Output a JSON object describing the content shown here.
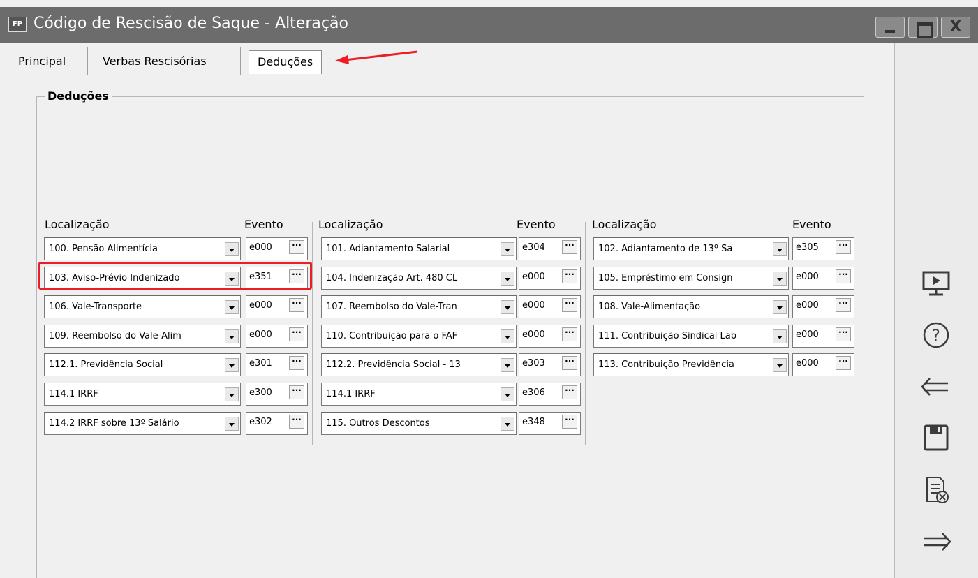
{
  "window": {
    "app_icon": "FP",
    "title": "Código de Rescisão de Saque - Alteração",
    "close_glyph": "X"
  },
  "tabs": [
    {
      "label": "Principal"
    },
    {
      "label": "Verbas Rescisórias"
    },
    {
      "label": "Deduções",
      "selected": true
    }
  ],
  "group": {
    "title": "Deduções"
  },
  "columns": [
    {
      "header_loc": "Localização",
      "header_ev": "Evento",
      "rows": [
        {
          "loc": "100. Pensão Alimentícia",
          "ev": "e000"
        },
        {
          "loc": "103. Aviso-Prévio Indenizado",
          "ev": "e351",
          "highlighted": true
        },
        {
          "loc": "106. Vale-Transporte",
          "ev": "e000"
        },
        {
          "loc": "109. Reembolso do Vale-Alim",
          "ev": "e000"
        },
        {
          "loc": "112.1. Previdência Social",
          "ev": "e301"
        },
        {
          "loc": "114.1 IRRF",
          "ev": "e300"
        },
        {
          "loc": "114.2 IRRF sobre 13º Salário",
          "ev": "e302"
        }
      ]
    },
    {
      "header_loc": "Localização",
      "header_ev": "Evento",
      "rows": [
        {
          "loc": "101. Adiantamento Salarial",
          "ev": "e304"
        },
        {
          "loc": "104. Indenização Art. 480 CL",
          "ev": "e000"
        },
        {
          "loc": "107. Reembolso do Vale-Tran",
          "ev": "e000"
        },
        {
          "loc": "110. Contribuição para o FAF",
          "ev": "e000"
        },
        {
          "loc": "112.2. Previdência Social - 13",
          "ev": "e303"
        },
        {
          "loc": "114.1 IRRF",
          "ev": "e306"
        },
        {
          "loc": "115. Outros Descontos",
          "ev": "e348"
        }
      ]
    },
    {
      "header_loc": "Localização",
      "header_ev": "Evento",
      "rows": [
        {
          "loc": "102. Adiantamento de 13º Sa",
          "ev": "e305"
        },
        {
          "loc": "105. Empréstimo em Consign",
          "ev": "e000"
        },
        {
          "loc": "108. Vale-Alimentação",
          "ev": "e000"
        },
        {
          "loc": "111. Contribuição Sindical Lab",
          "ev": "e000"
        },
        {
          "loc": "113. Contribuição Previdência",
          "ev": "e000"
        }
      ]
    }
  ],
  "side_toolbar": [
    {
      "icon": "monitor-play-icon"
    },
    {
      "icon": "help-icon"
    },
    {
      "icon": "back-arrow-icon"
    },
    {
      "icon": "save-icon"
    },
    {
      "icon": "cancel-document-icon"
    },
    {
      "icon": "forward-arrow-icon"
    }
  ],
  "colors": {
    "titlebar": "#6c6c6c",
    "highlight": "#ee1c24",
    "annotation_arrow": "#ee1c24"
  }
}
